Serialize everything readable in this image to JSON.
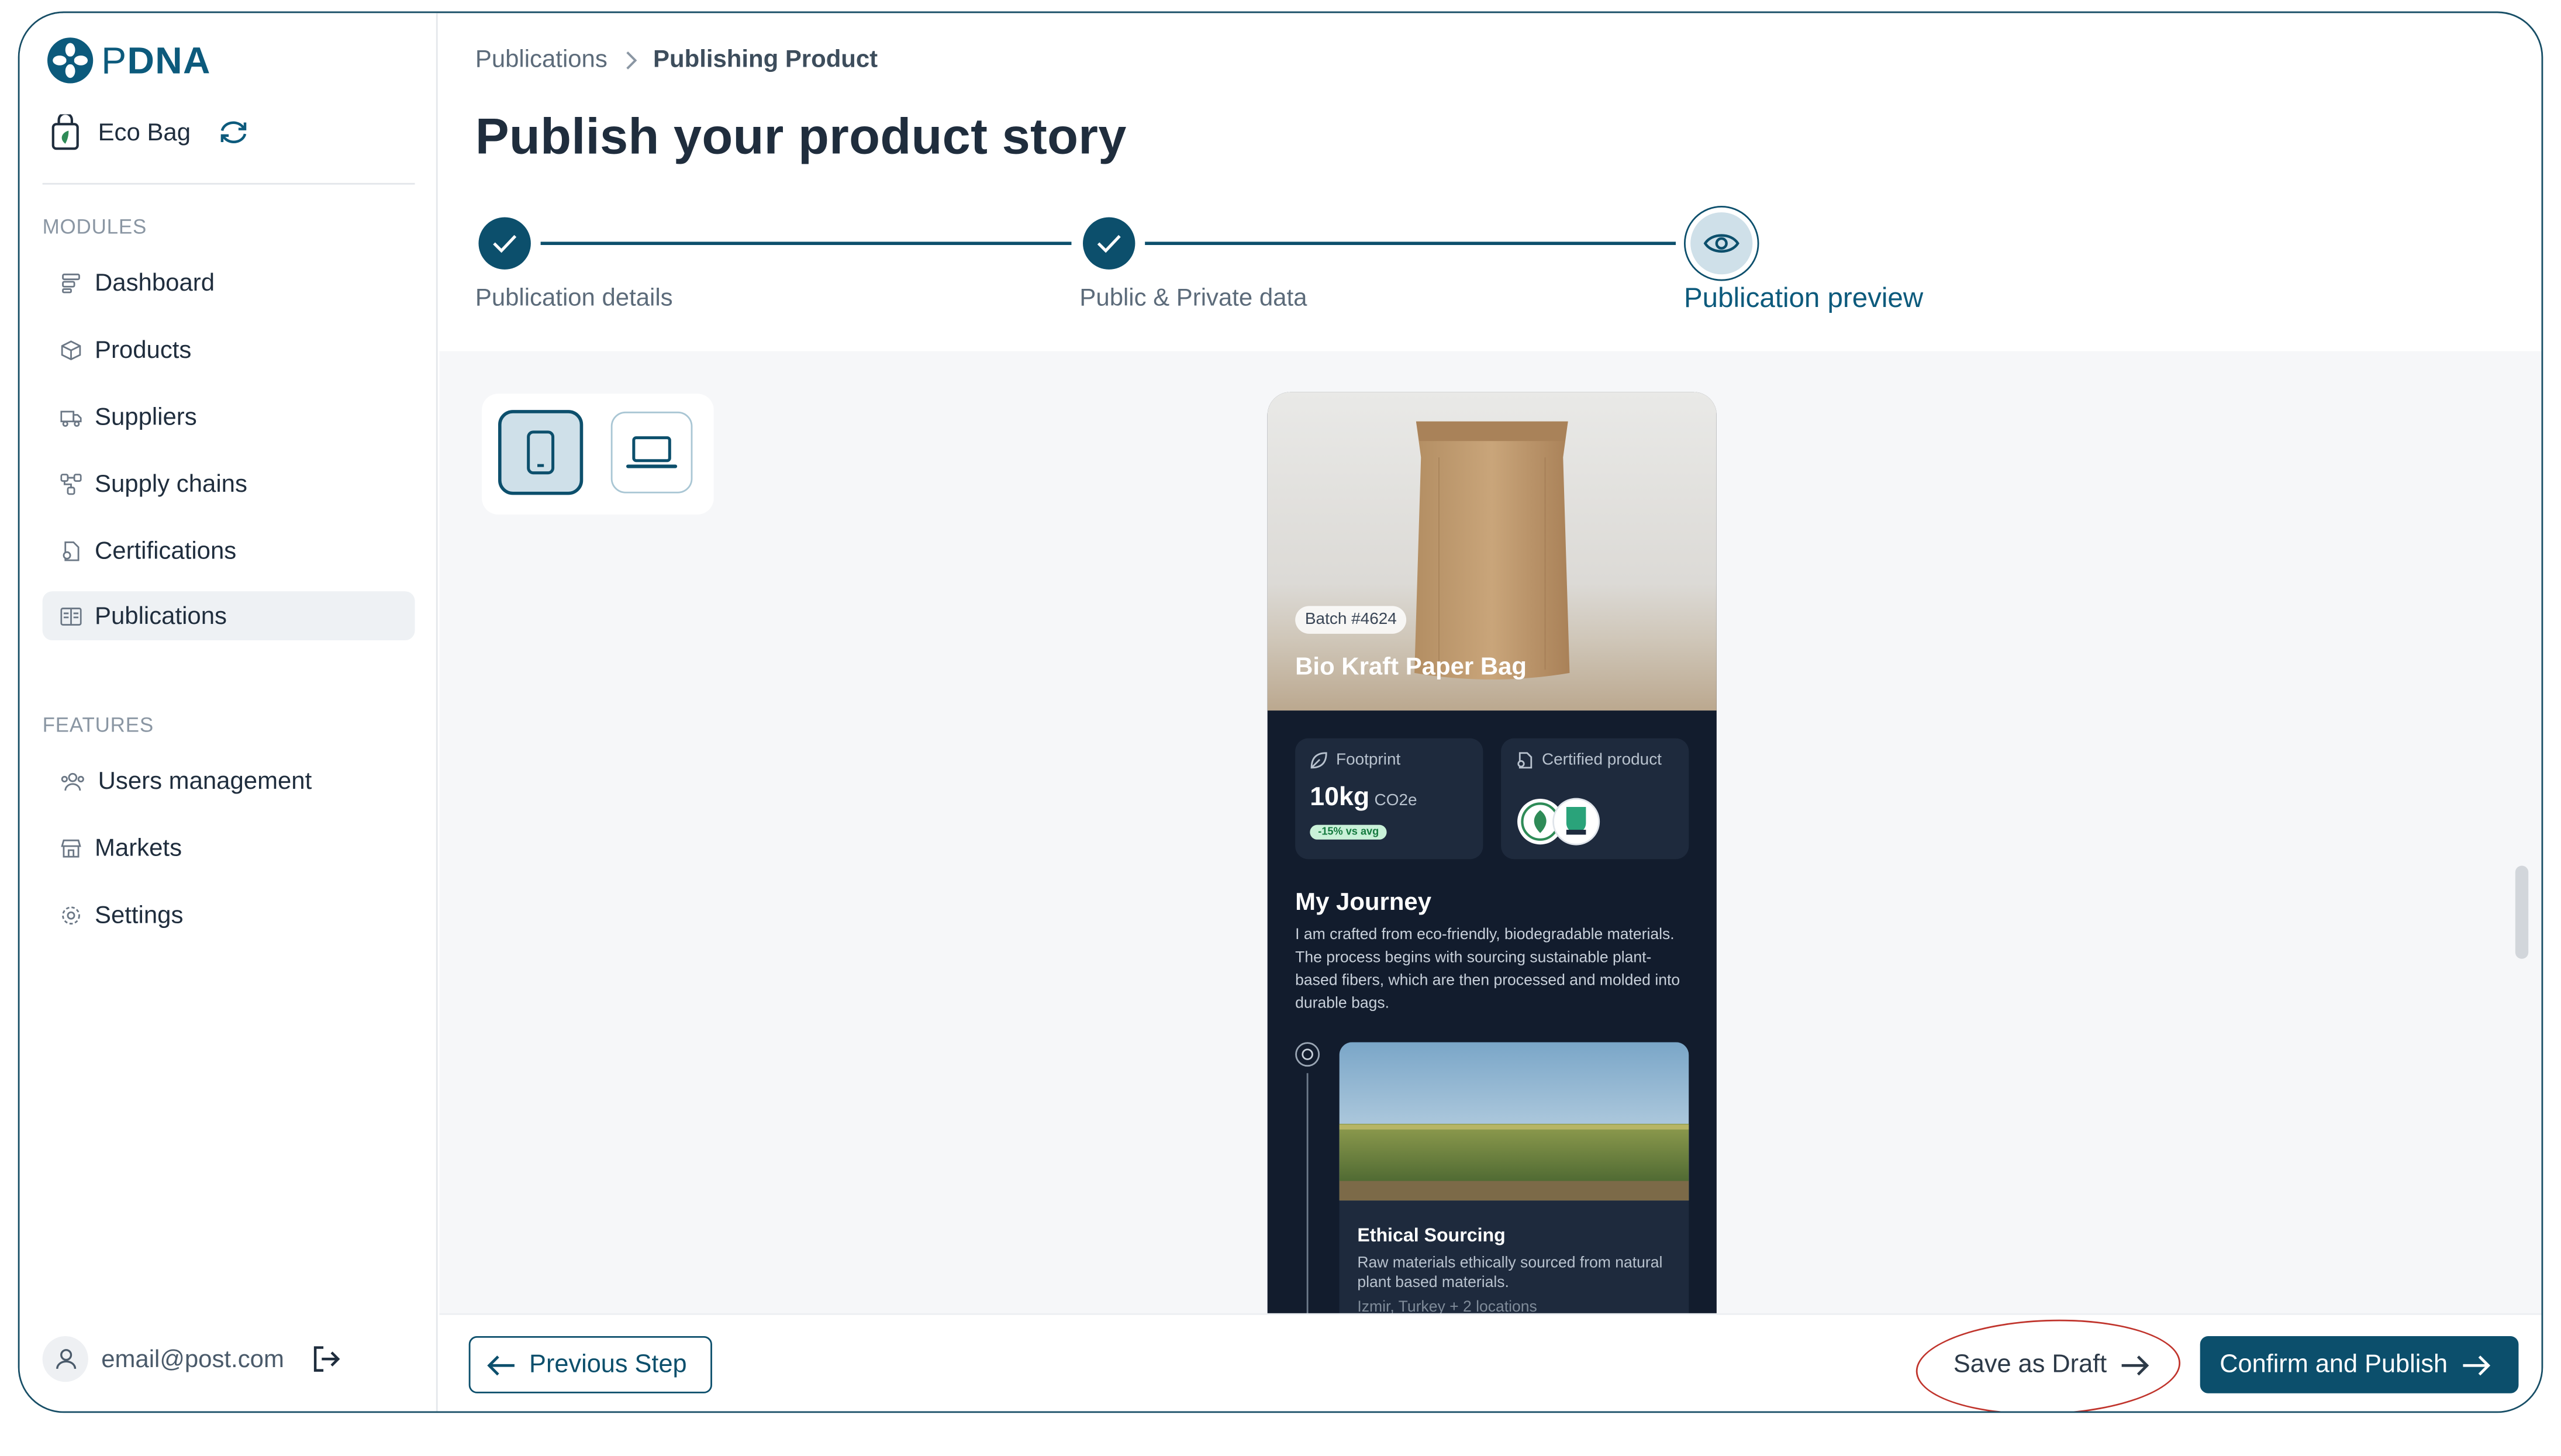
{
  "app": {
    "logo_prefix": "P",
    "logo_suffix": "DNA"
  },
  "product_switcher": {
    "name": "Eco Bag"
  },
  "sidebar": {
    "modules_label": "MODULES",
    "modules": [
      {
        "label": "Dashboard",
        "icon": "dashboard-icon"
      },
      {
        "label": "Products",
        "icon": "cube-icon"
      },
      {
        "label": "Suppliers",
        "icon": "truck-icon"
      },
      {
        "label": "Supply chains",
        "icon": "network-icon"
      },
      {
        "label": "Certifications",
        "icon": "certificate-icon"
      },
      {
        "label": "Publications",
        "icon": "publication-icon",
        "active": true
      }
    ],
    "features_label": "FEATURES",
    "features": [
      {
        "label": "Users management",
        "icon": "users-icon"
      },
      {
        "label": "Markets",
        "icon": "store-icon"
      },
      {
        "label": "Settings",
        "icon": "gear-icon"
      }
    ],
    "user_email": "email@post.com"
  },
  "breadcrumb": {
    "parent": "Publications",
    "current": "Publishing Product"
  },
  "page": {
    "title": "Publish your product story"
  },
  "stepper": {
    "steps": [
      {
        "label": "Publication details",
        "state": "done"
      },
      {
        "label": "Public & Private data",
        "state": "done"
      },
      {
        "label": "Publication preview",
        "state": "current"
      }
    ]
  },
  "preview": {
    "batch": "Batch #4624",
    "product_name": "Bio Kraft Paper Bag",
    "footprint_label": "Footprint",
    "footprint_value": "10kg",
    "footprint_unit": "CO2e",
    "footprint_badge": "-15% vs avg",
    "certified_label": "Certified product",
    "journey_title": "My Journey",
    "journey_text": "I am crafted from eco-friendly, biodegradable materials. The process begins with sourcing sustainable plant-based fibers, which are then processed and molded into durable bags.",
    "stage_title": "Ethical Sourcing",
    "stage_text": "Raw materials ethically sourced from natural plant based materials.",
    "stage_location": "Izmir, Turkey + 2 locations"
  },
  "footer": {
    "previous_label": "Previous Step",
    "draft_label": "Save as Draft",
    "publish_label": "Confirm and Publish"
  },
  "colors": {
    "primary": "#0c4f6c",
    "sidebar_active": "#eef1f4",
    "preview_bg": "#121c2d",
    "annotation": "#c0342c"
  }
}
